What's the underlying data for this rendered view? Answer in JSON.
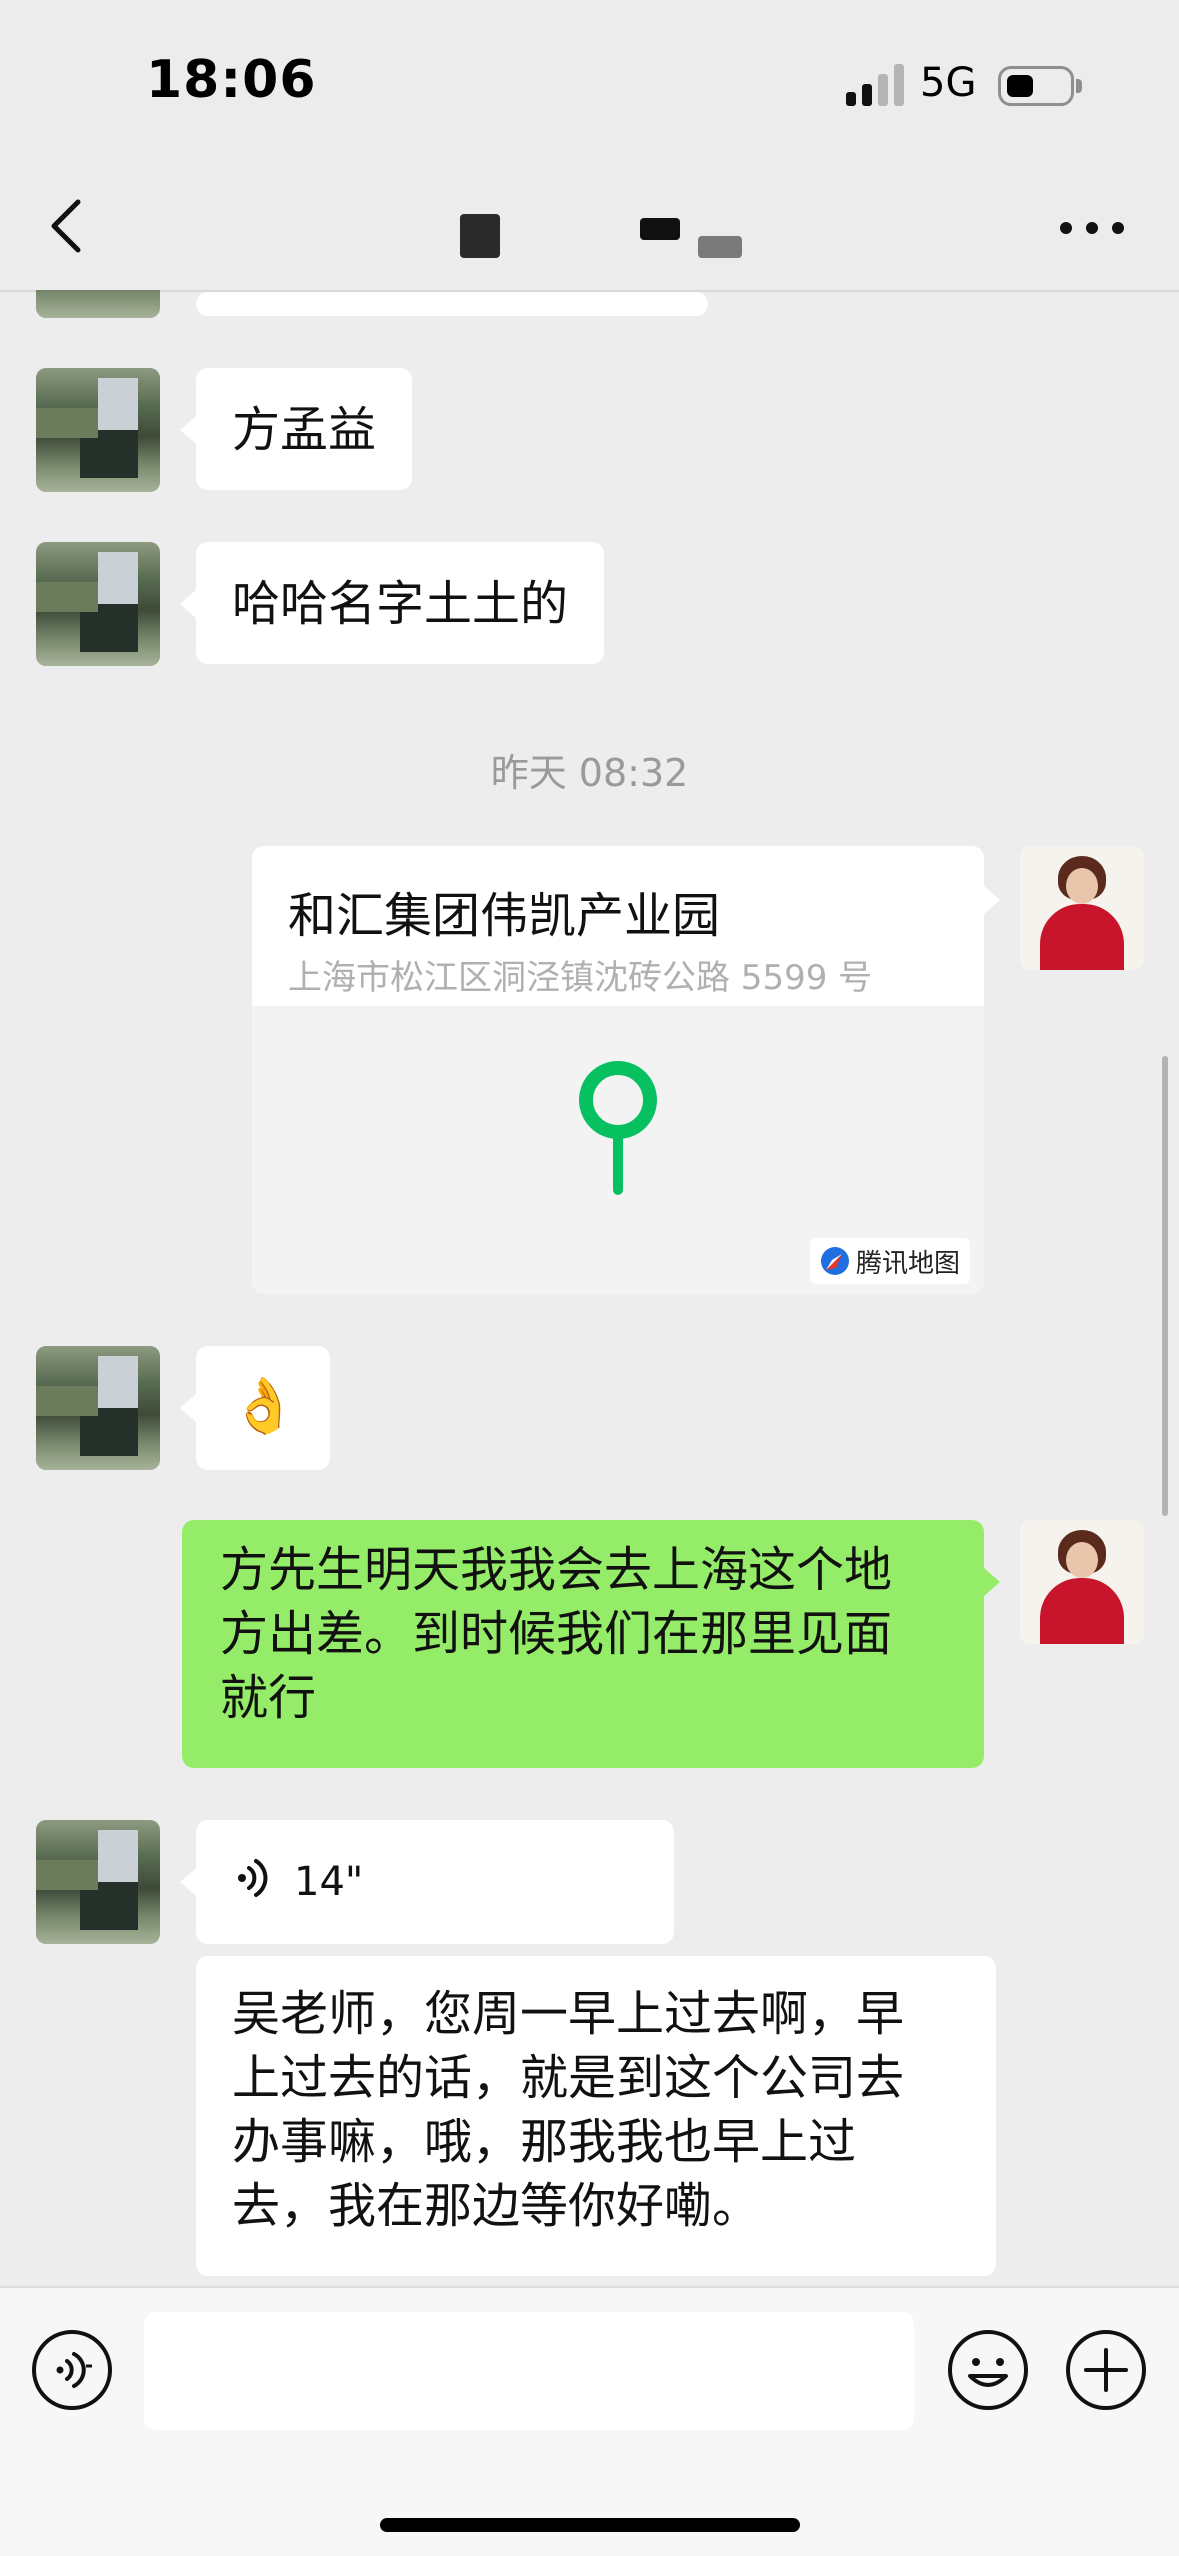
{
  "status_bar": {
    "time": "18:06",
    "network": "5G",
    "battery_level": 0.4
  },
  "header": {
    "back_icon": "chevron-left-icon",
    "more_icon": "more-icon"
  },
  "messages": [
    {
      "sender": "contact",
      "text": "方孟益"
    },
    {
      "sender": "contact",
      "text": "哈哈名字土土的"
    },
    {
      "type": "timestamp",
      "text": "昨天 08:32"
    },
    {
      "sender": "self",
      "type": "location",
      "title": "和汇集团伟凯产业园",
      "address": "上海市松江区洞泾镇沈砖公路 5599 号",
      "map_provider": "腾讯地图"
    },
    {
      "sender": "contact",
      "type": "emoji",
      "text": "👌"
    },
    {
      "sender": "self",
      "text_lines": [
        "方先生明天我我会去上海这个地",
        "方出差。到时候我们在那里见面",
        "就行"
      ]
    },
    {
      "sender": "contact",
      "type": "voice",
      "duration": "14\""
    },
    {
      "sender": "contact",
      "text_lines": [
        "吴老师，您周一早上过去啊，早",
        "上过去的话，就是到这个公司去",
        "办事嘛，哦，那我我也早上过",
        "去，我在那边等你好嘞。"
      ]
    }
  ],
  "input_bar": {
    "voice_icon": "voice-mode-icon",
    "emoji_icon": "emoji-icon",
    "add_icon": "plus-icon",
    "placeholder": ""
  },
  "colors": {
    "self_bubble": "#95ec69",
    "contact_bubble": "#ffffff",
    "background": "#ededed",
    "pin": "#07c160"
  }
}
